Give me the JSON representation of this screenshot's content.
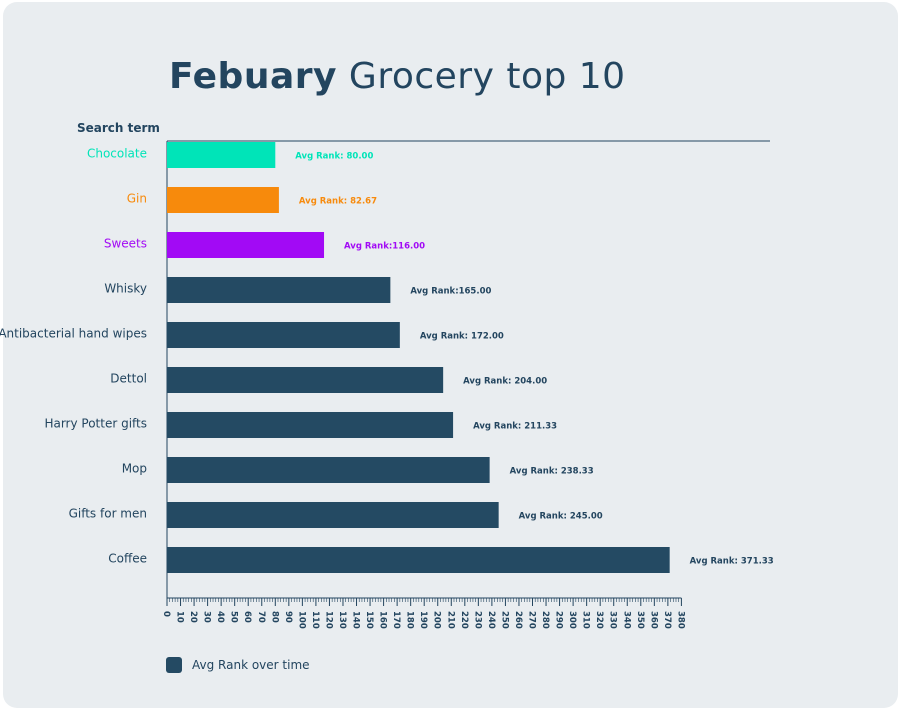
{
  "title": {
    "bold": "Febuary",
    "rest": "Grocery top 10"
  },
  "colors": {
    "default": "#244a63",
    "chocolate": "#00e4b8",
    "gin": "#f78a0c",
    "sweets": "#a20af5",
    "background": "#e9edf0",
    "text": "#23455f"
  },
  "legend": {
    "label": "Avg Rank over time"
  },
  "chart_data": {
    "type": "bar",
    "orientation": "horizontal",
    "ylabel": "Search term",
    "categories": [
      "Chocolate",
      "Gin",
      "Sweets",
      "Whisky",
      "Antibacterial hand wipes",
      "Dettol",
      "Harry Potter gifts",
      "Mop",
      "Gifts for men",
      "Coffee"
    ],
    "values": [
      80.0,
      82.67,
      116.0,
      165.0,
      172.0,
      204.0,
      211.33,
      238.33,
      245.0,
      371.33
    ],
    "labels": [
      "Avg Rank: 80.00",
      "Avg Rank: 82.67",
      "Avg Rank:116.00",
      "Avg Rank:165.00",
      "Avg Rank: 172.00",
      "Avg Rank: 204.00",
      "Avg Rank: 211.33",
      "Avg Rank: 238.33",
      "Avg Rank: 245.00",
      "Avg Rank: 371.33"
    ],
    "bar_colors": [
      "#00e4b8",
      "#f78a0c",
      "#a20af5",
      "#244a63",
      "#244a63",
      "#244a63",
      "#244a63",
      "#244a63",
      "#244a63",
      "#244a63"
    ],
    "xlim": [
      0,
      380
    ],
    "xticks": [
      0,
      10,
      20,
      30,
      40,
      50,
      60,
      70,
      80,
      90,
      100,
      110,
      120,
      130,
      140,
      150,
      160,
      170,
      180,
      190,
      200,
      210,
      220,
      230,
      240,
      250,
      260,
      270,
      280,
      290,
      300,
      310,
      320,
      330,
      340,
      350,
      360,
      370,
      380
    ],
    "grid": false,
    "legend": "bottom-left"
  }
}
